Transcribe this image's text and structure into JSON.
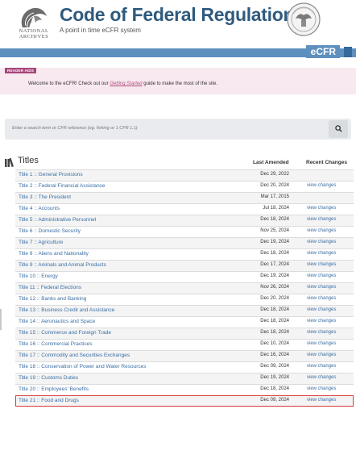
{
  "header": {
    "title": "Code of Federal Regulations",
    "subtitle": "A point in time eCFR system",
    "archives_line1": "NATIONAL",
    "archives_line2": "ARCHIVES",
    "ecfr_label": "eCFR"
  },
  "reader_aids": {
    "tag": "READER AIDS",
    "message_pre": "Welcome to the eCFR! Check out our ",
    "message_link": "Getting Started",
    "message_post": " guide to make the most of the site."
  },
  "search": {
    "placeholder": "Enter a search term or CFR reference (eg. fishing or 1 CFR 1.1)"
  },
  "titles": {
    "heading": "Titles",
    "col_amended": "Last Amended",
    "col_recent": "Recent Changes",
    "rows": [
      {
        "title": "Title 1  :: General Provisions",
        "date": "Dec 29, 2022",
        "changes": ""
      },
      {
        "title": "Title 2  :: Federal Financial Assistance",
        "date": "Dec 20, 2024",
        "changes": "view changes"
      },
      {
        "title": "Title 3  :: The President",
        "date": "Mar 17, 2015",
        "changes": ""
      },
      {
        "title": "Title 4  :: Accounts",
        "date": "Jul 18, 2024",
        "changes": "view changes"
      },
      {
        "title": "Title 5  :: Administrative Personnel",
        "date": "Dec 18, 2024",
        "changes": "view changes"
      },
      {
        "title": "Title 6  :: Domestic Security",
        "date": "Nov 25, 2024",
        "changes": "view changes"
      },
      {
        "title": "Title 7  :: Agriculture",
        "date": "Dec 19, 2024",
        "changes": "view changes"
      },
      {
        "title": "Title 8  :: Aliens and Nationality",
        "date": "Dec 18, 2024",
        "changes": "view changes"
      },
      {
        "title": "Title 9  :: Animals and Animal Products",
        "date": "Dec 17, 2024",
        "changes": "view changes"
      },
      {
        "title": "Title 10 :: Energy",
        "date": "Dec 19, 2024",
        "changes": "view changes"
      },
      {
        "title": "Title 11 :: Federal Elections",
        "date": "Nov 26, 2024",
        "changes": "view changes"
      },
      {
        "title": "Title 12 :: Banks and Banking",
        "date": "Dec 20, 2024",
        "changes": "view changes"
      },
      {
        "title": "Title 13 :: Business Credit and Assistance",
        "date": "Dec 18, 2024",
        "changes": "view changes"
      },
      {
        "title": "Title 14 :: Aeronautics and Space",
        "date": "Dec 18, 2024",
        "changes": "view changes"
      },
      {
        "title": "Title 15 :: Commerce and Foreign Trade",
        "date": "Dec 18, 2024",
        "changes": "view changes"
      },
      {
        "title": "Title 16 :: Commercial Practices",
        "date": "Dec 10, 2024",
        "changes": "view changes"
      },
      {
        "title": "Title 17 :: Commodity and Securities Exchanges",
        "date": "Dec 16, 2024",
        "changes": "view changes"
      },
      {
        "title": "Title 18 :: Conservation of Power and Water Resources",
        "date": "Dec 09, 2024",
        "changes": "view changes"
      },
      {
        "title": "Title 19 :: Customs Duties",
        "date": "Dec 19, 2024",
        "changes": "view changes"
      },
      {
        "title": "Title 20 :: Employees' Benefits",
        "date": "Dec 18, 2024",
        "changes": "view changes"
      },
      {
        "title": "Title 21 :: Food and Drugs",
        "date": "Dec 09, 2024",
        "changes": "view changes"
      }
    ]
  },
  "colors": {
    "link": "#3a6ea5",
    "bar": "#5d8fbf",
    "highlight": "#d83a3a",
    "reader_aids_bg": "#f8e8ef"
  }
}
